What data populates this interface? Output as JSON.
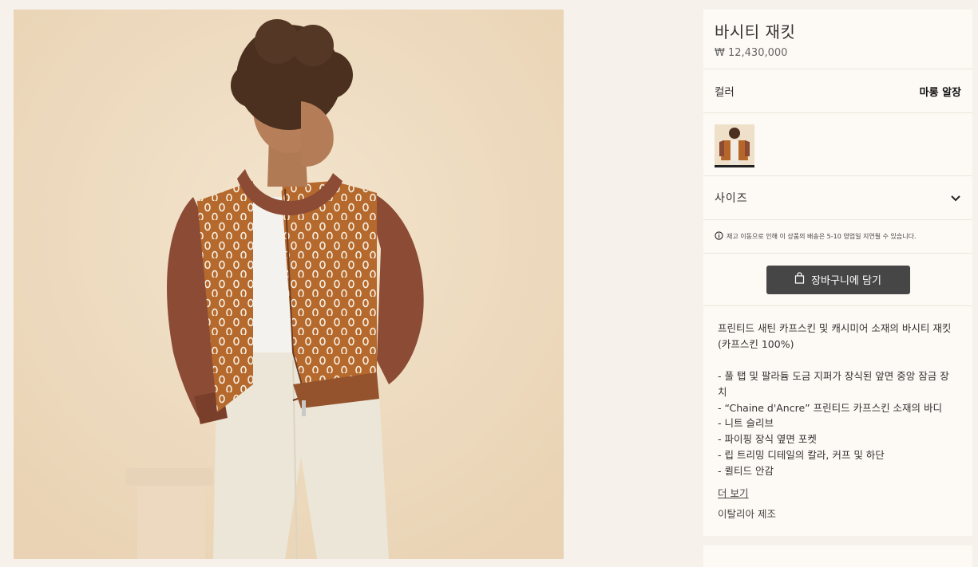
{
  "product": {
    "title": "바시티 재킷",
    "price": "₩ 12,430,000"
  },
  "color": {
    "label": "컬러",
    "value": "마롱 알장",
    "swatch_colors": [
      "#b5672b",
      "#8a4a33",
      "#f2ede4"
    ]
  },
  "size": {
    "label": "사이즈"
  },
  "notice": {
    "text": "재고 이동으로 인해 이 상품의 배송은 5-10 영업일 지연될 수 있습니다."
  },
  "cart": {
    "label": "장바구니에 담기"
  },
  "description": {
    "intro": "프린티드 새틴 카프스킨 및 캐시미어 소재의 바시티 재킷(카프스킨 100%)",
    "bullets": [
      "- 풀 탭 및 팔라듐 도금 지퍼가 장식된 앞면 중앙 잠금 장치",
      "- “Chaine d'Ancre” 프린티드 카프스킨 소재의 바디",
      "- 니트 슬리브",
      "- 파이핑 장식 옆면 포켓",
      "- 립 트리밍 디테일의 칼라, 커프 및 하단",
      "- 퀼티드 안감"
    ],
    "more": "더 보기",
    "origin": "이탈리아 제조"
  },
  "icons": {
    "chevron": "chevron-down-icon",
    "info": "info-icon",
    "bag": "shopping-bag-icon"
  }
}
